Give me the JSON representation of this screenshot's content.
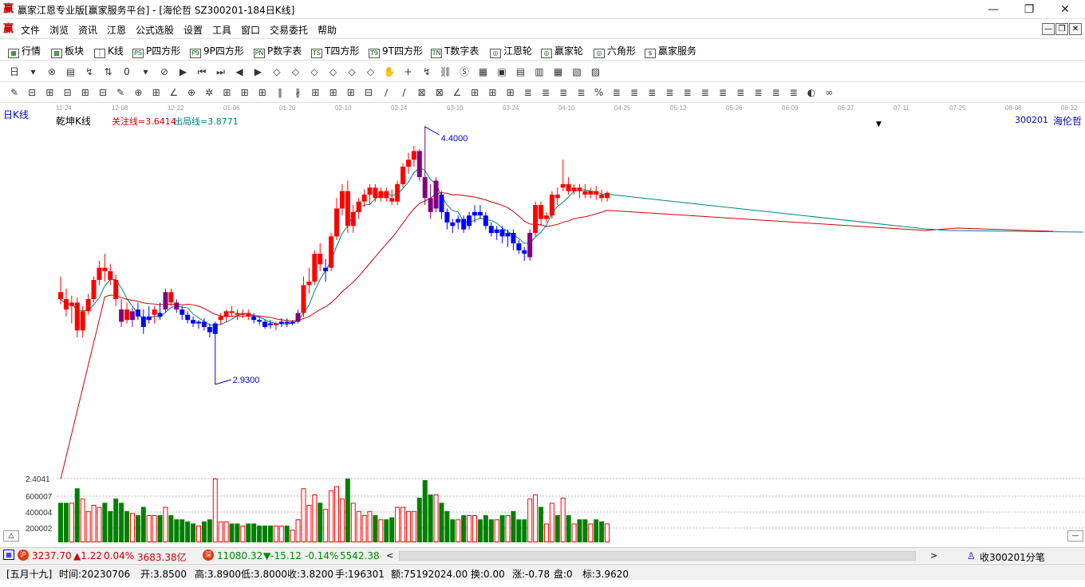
{
  "window": {
    "title": "赢家江恩专业版[赢家服务平台] - [海伦哲  SZ300201-184日K线]",
    "logo_char": "赢",
    "minimize": "—",
    "restore": "❐",
    "close": "✕"
  },
  "menu": {
    "items": [
      "文件",
      "浏览",
      "资讯",
      "江恩",
      "公式选股",
      "设置",
      "工具",
      "窗口",
      "交易委托",
      "帮助"
    ]
  },
  "nav": {
    "items": [
      {
        "icon": "▦",
        "label": "行情"
      },
      {
        "icon": "▩",
        "label": "板块"
      },
      {
        "icon": "┆",
        "label": "K线"
      },
      {
        "icon": "PS",
        "label": "P四方形"
      },
      {
        "icon": "P9",
        "label": "9P四方形"
      },
      {
        "icon": "PN",
        "label": "P数字表"
      },
      {
        "icon": "TS",
        "label": "T四方形"
      },
      {
        "icon": "T9",
        "label": "9T四方形"
      },
      {
        "icon": "TN",
        "label": "T数字表"
      },
      {
        "icon": "◎",
        "label": "江恩轮"
      },
      {
        "icon": "◎",
        "label": "赢家轮"
      },
      {
        "icon": "◎",
        "label": "六角形"
      },
      {
        "icon": "$",
        "label": "赢家服务"
      }
    ]
  },
  "toolbar1": {
    "icons": [
      "日",
      "▾",
      "⊗",
      "▤",
      "↯",
      "⇅",
      "0",
      "▾",
      "⊘",
      "▶",
      "⏮",
      "⏭",
      "◀",
      "▶",
      "◇",
      "◇",
      "◇",
      "◇",
      "◇",
      "◇",
      "✋",
      "+",
      "↯",
      "⛓",
      "Ⓢ",
      "▦",
      "▣",
      "▤",
      "▥",
      "▦",
      "▧",
      "▨"
    ]
  },
  "toolbar2": {
    "icons": [
      "✎",
      "⊟",
      "⊞",
      "⊟",
      "⊞",
      "⊟",
      "✎",
      "⊕",
      "⊞",
      "∠",
      "⊕",
      "✲",
      "⊞",
      "⊞",
      "⊞",
      "∥",
      "∦",
      "⊞",
      "⊞",
      "⊞",
      "⊟",
      "∕",
      "∕",
      "⊠",
      "⊠",
      "∠",
      "⊞",
      "⊞",
      "⊞",
      "≣",
      "≣",
      "≣",
      "≣",
      "%",
      "≣",
      "≣",
      "≣",
      "≣",
      "≣",
      "≣",
      "≣",
      "≣",
      "≣",
      "≣",
      "≣",
      "◐",
      "∞"
    ]
  },
  "chart": {
    "period_label": "日K线",
    "indicator_label": "乾坤K线",
    "focus_line": "关注线=3.6414",
    "exit_line": "出局线=3.8771",
    "stock_code": "300201",
    "stock_name": "海伦哲",
    "high_marker": "4.4000",
    "low_marker": "2.9300",
    "dates": [
      "11-24",
      "12-08",
      "12-22",
      "01-06",
      "01-20",
      "02-10",
      "02-24",
      "03-10",
      "03-24",
      "04-10",
      "04-25",
      "05-12",
      "05-26",
      "06-09",
      "06-27",
      "07-11",
      "07-25",
      "08-08",
      "08-22"
    ],
    "volume_labels": [
      "2.4041",
      "600007",
      "400004",
      "200002"
    ],
    "up_color": "#ff0000",
    "down_color": "#0000ff",
    "purple_color": "#800080",
    "ma_short_color": "#008080",
    "ma_long_color": "#cc0000",
    "vol_up_color": "#ff0000",
    "vol_down_color": "#008000"
  },
  "chart_data": {
    "type": "candlestick",
    "price_range": [
      2.93,
      4.4
    ],
    "candles": [
      {
        "o": 3.46,
        "h": 3.55,
        "l": 3.39,
        "c": 3.42,
        "k": "u"
      },
      {
        "o": 3.42,
        "h": 3.48,
        "l": 3.32,
        "c": 3.36,
        "k": "u"
      },
      {
        "o": 3.38,
        "h": 3.44,
        "l": 3.28,
        "c": 3.4,
        "k": "u"
      },
      {
        "o": 3.4,
        "h": 3.43,
        "l": 3.2,
        "c": 3.24,
        "k": "u"
      },
      {
        "o": 3.24,
        "h": 3.38,
        "l": 3.2,
        "c": 3.35,
        "k": "u"
      },
      {
        "o": 3.35,
        "h": 3.45,
        "l": 3.33,
        "c": 3.42,
        "k": "u"
      },
      {
        "o": 3.42,
        "h": 3.55,
        "l": 3.4,
        "c": 3.53,
        "k": "u"
      },
      {
        "o": 3.53,
        "h": 3.64,
        "l": 3.5,
        "c": 3.6,
        "k": "u"
      },
      {
        "o": 3.6,
        "h": 3.68,
        "l": 3.52,
        "c": 3.58,
        "k": "u"
      },
      {
        "o": 3.58,
        "h": 3.62,
        "l": 3.5,
        "c": 3.53,
        "k": "u"
      },
      {
        "o": 3.53,
        "h": 3.56,
        "l": 3.38,
        "c": 3.42,
        "k": "u"
      },
      {
        "o": 3.36,
        "h": 3.42,
        "l": 3.26,
        "c": 3.29,
        "k": "p"
      },
      {
        "o": 3.36,
        "h": 3.4,
        "l": 3.28,
        "c": 3.3,
        "k": "u"
      },
      {
        "o": 3.3,
        "h": 3.37,
        "l": 3.26,
        "c": 3.35,
        "k": "p"
      },
      {
        "o": 3.36,
        "h": 3.4,
        "l": 3.3,
        "c": 3.32,
        "k": "d"
      },
      {
        "o": 3.32,
        "h": 3.36,
        "l": 3.22,
        "c": 3.26,
        "k": "d"
      },
      {
        "o": 3.3,
        "h": 3.38,
        "l": 3.28,
        "c": 3.32,
        "k": "d"
      },
      {
        "o": 3.33,
        "h": 3.38,
        "l": 3.28,
        "c": 3.36,
        "k": "u"
      },
      {
        "o": 3.34,
        "h": 3.4,
        "l": 3.3,
        "c": 3.32,
        "k": "d"
      },
      {
        "o": 3.36,
        "h": 3.48,
        "l": 3.34,
        "c": 3.46,
        "k": "p"
      },
      {
        "o": 3.46,
        "h": 3.48,
        "l": 3.38,
        "c": 3.4,
        "k": "u"
      },
      {
        "o": 3.4,
        "h": 3.42,
        "l": 3.34,
        "c": 3.36,
        "k": "p"
      },
      {
        "o": 3.36,
        "h": 3.38,
        "l": 3.3,
        "c": 3.33,
        "k": "d"
      },
      {
        "o": 3.33,
        "h": 3.35,
        "l": 3.28,
        "c": 3.3,
        "k": "d"
      },
      {
        "o": 3.3,
        "h": 3.32,
        "l": 3.26,
        "c": 3.28,
        "k": "d"
      },
      {
        "o": 3.28,
        "h": 3.3,
        "l": 3.25,
        "c": 3.29,
        "k": "d"
      },
      {
        "o": 3.29,
        "h": 3.31,
        "l": 3.24,
        "c": 3.26,
        "k": "d"
      },
      {
        "o": 3.26,
        "h": 3.28,
        "l": 3.2,
        "c": 3.23,
        "k": "d"
      },
      {
        "o": 3.22,
        "h": 3.29,
        "l": 2.93,
        "c": 3.28,
        "k": "d"
      },
      {
        "o": 3.3,
        "h": 3.34,
        "l": 3.27,
        "c": 3.32,
        "k": "u"
      },
      {
        "o": 3.32,
        "h": 3.36,
        "l": 3.29,
        "c": 3.35,
        "k": "u"
      },
      {
        "o": 3.35,
        "h": 3.38,
        "l": 3.32,
        "c": 3.34,
        "k": "u"
      },
      {
        "o": 3.34,
        "h": 3.36,
        "l": 3.3,
        "c": 3.33,
        "k": "u"
      },
      {
        "o": 3.33,
        "h": 3.36,
        "l": 3.31,
        "c": 3.34,
        "k": "u"
      },
      {
        "o": 3.34,
        "h": 3.36,
        "l": 3.3,
        "c": 3.32,
        "k": "u"
      },
      {
        "o": 3.32,
        "h": 3.34,
        "l": 3.28,
        "c": 3.3,
        "k": "d"
      },
      {
        "o": 3.3,
        "h": 3.32,
        "l": 3.27,
        "c": 3.29,
        "k": "d"
      },
      {
        "o": 3.29,
        "h": 3.3,
        "l": 3.25,
        "c": 3.26,
        "k": "d"
      },
      {
        "o": 3.28,
        "h": 3.3,
        "l": 3.25,
        "c": 3.27,
        "k": "d"
      },
      {
        "o": 3.27,
        "h": 3.29,
        "l": 3.24,
        "c": 3.28,
        "k": "u"
      },
      {
        "o": 3.28,
        "h": 3.31,
        "l": 3.26,
        "c": 3.29,
        "k": "d"
      },
      {
        "o": 3.29,
        "h": 3.31,
        "l": 3.26,
        "c": 3.28,
        "k": "d"
      },
      {
        "o": 3.28,
        "h": 3.3,
        "l": 3.27,
        "c": 3.29,
        "k": "d"
      },
      {
        "o": 3.29,
        "h": 3.36,
        "l": 3.28,
        "c": 3.34,
        "k": "p"
      },
      {
        "o": 3.34,
        "h": 3.55,
        "l": 3.32,
        "c": 3.5,
        "k": "u"
      },
      {
        "o": 3.5,
        "h": 3.6,
        "l": 3.45,
        "c": 3.52,
        "k": "u"
      },
      {
        "o": 3.52,
        "h": 3.7,
        "l": 3.5,
        "c": 3.68,
        "k": "u"
      },
      {
        "o": 3.68,
        "h": 3.74,
        "l": 3.58,
        "c": 3.62,
        "k": "u"
      },
      {
        "o": 3.58,
        "h": 3.65,
        "l": 3.52,
        "c": 3.6,
        "k": "d"
      },
      {
        "o": 3.6,
        "h": 3.8,
        "l": 3.58,
        "c": 3.78,
        "k": "u"
      },
      {
        "o": 3.78,
        "h": 4.0,
        "l": 3.76,
        "c": 3.94,
        "k": "u"
      },
      {
        "o": 3.94,
        "h": 4.08,
        "l": 3.9,
        "c": 4.04,
        "k": "u"
      },
      {
        "o": 4.04,
        "h": 4.1,
        "l": 3.8,
        "c": 3.84,
        "k": "u"
      },
      {
        "o": 3.84,
        "h": 3.96,
        "l": 3.8,
        "c": 3.92,
        "k": "u"
      },
      {
        "o": 3.92,
        "h": 4.0,
        "l": 3.88,
        "c": 3.98,
        "k": "u"
      },
      {
        "o": 3.98,
        "h": 4.05,
        "l": 3.95,
        "c": 4.02,
        "k": "u"
      },
      {
        "o": 4.02,
        "h": 4.08,
        "l": 3.96,
        "c": 4.06,
        "k": "u"
      },
      {
        "o": 4.06,
        "h": 4.08,
        "l": 3.98,
        "c": 4.0,
        "k": "u"
      },
      {
        "o": 4.0,
        "h": 4.06,
        "l": 3.98,
        "c": 4.04,
        "k": "u"
      },
      {
        "o": 4.04,
        "h": 4.06,
        "l": 3.98,
        "c": 4.0,
        "k": "u"
      },
      {
        "o": 4.0,
        "h": 4.05,
        "l": 3.96,
        "c": 3.98,
        "k": "u"
      },
      {
        "o": 3.98,
        "h": 4.1,
        "l": 3.96,
        "c": 4.08,
        "k": "u"
      },
      {
        "o": 4.08,
        "h": 4.2,
        "l": 4.06,
        "c": 4.18,
        "k": "u"
      },
      {
        "o": 4.18,
        "h": 4.26,
        "l": 4.14,
        "c": 4.22,
        "k": "u"
      },
      {
        "o": 4.22,
        "h": 4.3,
        "l": 4.18,
        "c": 4.27,
        "k": "u"
      },
      {
        "o": 4.27,
        "h": 4.28,
        "l": 4.1,
        "c": 4.12,
        "k": "p"
      },
      {
        "o": 4.12,
        "h": 4.4,
        "l": 3.96,
        "c": 4.0,
        "k": "p"
      },
      {
        "o": 4.0,
        "h": 4.08,
        "l": 3.88,
        "c": 3.92,
        "k": "p"
      },
      {
        "o": 3.94,
        "h": 4.12,
        "l": 3.92,
        "c": 4.1,
        "k": "p"
      },
      {
        "o": 4.02,
        "h": 4.04,
        "l": 3.88,
        "c": 3.92,
        "k": "d"
      },
      {
        "o": 3.92,
        "h": 3.94,
        "l": 3.82,
        "c": 3.86,
        "k": "d"
      },
      {
        "o": 3.86,
        "h": 3.88,
        "l": 3.8,
        "c": 3.84,
        "k": "d"
      },
      {
        "o": 3.86,
        "h": 3.9,
        "l": 3.82,
        "c": 3.88,
        "k": "d"
      },
      {
        "o": 3.88,
        "h": 3.9,
        "l": 3.8,
        "c": 3.82,
        "k": "d"
      },
      {
        "o": 3.84,
        "h": 3.92,
        "l": 3.82,
        "c": 3.9,
        "k": "d"
      },
      {
        "o": 3.9,
        "h": 3.96,
        "l": 3.86,
        "c": 3.92,
        "k": "d"
      },
      {
        "o": 3.92,
        "h": 3.96,
        "l": 3.88,
        "c": 3.9,
        "k": "d"
      },
      {
        "o": 3.9,
        "h": 3.92,
        "l": 3.82,
        "c": 3.84,
        "k": "d"
      },
      {
        "o": 3.84,
        "h": 3.86,
        "l": 3.78,
        "c": 3.8,
        "k": "d"
      },
      {
        "o": 3.8,
        "h": 3.84,
        "l": 3.76,
        "c": 3.82,
        "k": "d"
      },
      {
        "o": 3.82,
        "h": 3.84,
        "l": 3.74,
        "c": 3.78,
        "k": "d"
      },
      {
        "o": 3.78,
        "h": 3.82,
        "l": 3.72,
        "c": 3.8,
        "k": "d"
      },
      {
        "o": 3.8,
        "h": 3.82,
        "l": 3.7,
        "c": 3.74,
        "k": "d"
      },
      {
        "o": 3.74,
        "h": 3.76,
        "l": 3.68,
        "c": 3.7,
        "k": "d"
      },
      {
        "o": 3.7,
        "h": 3.72,
        "l": 3.64,
        "c": 3.68,
        "k": "d"
      },
      {
        "o": 3.66,
        "h": 3.82,
        "l": 3.64,
        "c": 3.8,
        "k": "p"
      },
      {
        "o": 3.8,
        "h": 3.98,
        "l": 3.78,
        "c": 3.96,
        "k": "u"
      },
      {
        "o": 3.96,
        "h": 3.98,
        "l": 3.84,
        "c": 3.88,
        "k": "u"
      },
      {
        "o": 3.88,
        "h": 3.92,
        "l": 3.86,
        "c": 3.9,
        "k": "u"
      },
      {
        "o": 3.9,
        "h": 4.04,
        "l": 3.88,
        "c": 4.02,
        "k": "u"
      },
      {
        "o": 4.02,
        "h": 4.06,
        "l": 3.96,
        "c": 4.0,
        "k": "u"
      },
      {
        "o": 4.06,
        "h": 4.22,
        "l": 4.04,
        "c": 4.08,
        "k": "u"
      },
      {
        "o": 4.08,
        "h": 4.12,
        "l": 4.02,
        "c": 4.04,
        "k": "u"
      },
      {
        "o": 4.04,
        "h": 4.08,
        "l": 4.02,
        "c": 4.06,
        "k": "u"
      },
      {
        "o": 4.06,
        "h": 4.08,
        "l": 4.0,
        "c": 4.04,
        "k": "u"
      },
      {
        "o": 4.04,
        "h": 4.08,
        "l": 4.0,
        "c": 4.02,
        "k": "u"
      },
      {
        "o": 4.02,
        "h": 4.06,
        "l": 4.0,
        "c": 4.04,
        "k": "u"
      },
      {
        "o": 4.04,
        "h": 4.07,
        "l": 3.99,
        "c": 4.02,
        "k": "u"
      },
      {
        "o": 4.02,
        "h": 4.05,
        "l": 3.98,
        "c": 4.0,
        "k": "u"
      },
      {
        "o": 4.0,
        "h": 4.04,
        "l": 3.98,
        "c": 4.03,
        "k": "u"
      }
    ],
    "volume_range": [
      0,
      2.4041
    ]
  },
  "status": {
    "idx1_value": "3237.70",
    "idx1_change": "▲1.22",
    "idx1_pct": "0.04%",
    "idx1_amount": "3683.38亿",
    "idx2_value": "11080.32",
    "idx2_change": "▼-15.12",
    "idx2_pct": "-0.14%",
    "idx2_amount": "5542.38",
    "right_text": "收300201分笔"
  },
  "info": {
    "lunar": "[五月十九]",
    "date": "时间:20230706",
    "open": "开:3.8500",
    "high": "高:3.8900",
    "low": "低:3.8000",
    "close": "收:3.8200",
    "hand": "手:196301",
    "amount": "额:75192024.00",
    "turnover": "换:0.00",
    "change": "涨:-0.78",
    "disk": "盘:0",
    "mark": "标:3.9620"
  }
}
